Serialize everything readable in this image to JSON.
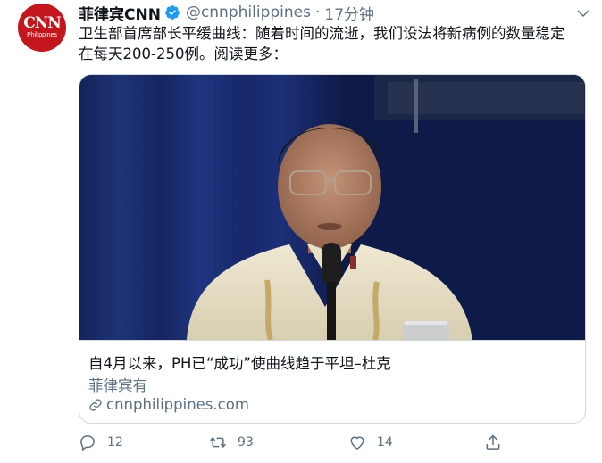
{
  "account": {
    "avatar_logo": "CNN",
    "avatar_sub": "Philippines",
    "name": "菲律宾CNN",
    "handle": "@cnnphilippines",
    "separator": "·",
    "time": "17分钟",
    "verified_icon": "verified-badge-icon",
    "menu_icon": "chevron-down-icon"
  },
  "tweet": {
    "text_line1": "卫生部首席部长平缓曲线：随着时间的流逝，我们设法将新病例的数量稳定",
    "text_line2": "在每天200-250例。阅读更多："
  },
  "card": {
    "title": "自4月以来，PH已“成功”使曲线趋于平坦–杜克",
    "description": "菲律宾有",
    "link_icon": "link-icon",
    "link": "cnnphilippines.com"
  },
  "actions": {
    "reply_count": "12",
    "retweet_count": "93",
    "like_count": "14",
    "icons": [
      "reply-icon",
      "retweet-icon",
      "like-icon",
      "share-icon"
    ]
  },
  "colors": {
    "brand_red": "#c4161c",
    "verified_blue": "#1d9bf0",
    "secondary_text": "#5b7083",
    "border": "#cfd9de"
  }
}
